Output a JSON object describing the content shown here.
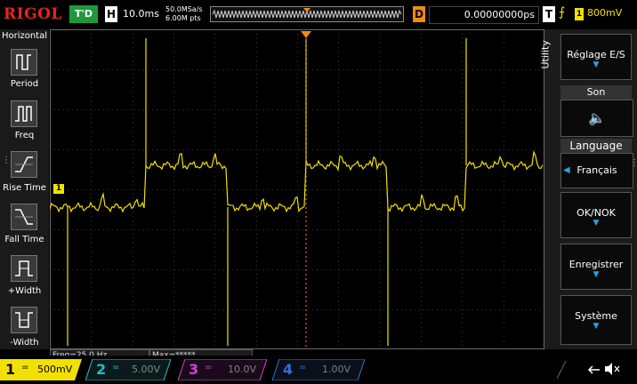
{
  "brand": {
    "logo": "RIGOL"
  },
  "top": {
    "status": "T'D",
    "horizontal_key": "H",
    "timebase": "10.0ms",
    "sample_rate": "50.0MSa/s",
    "memory_depth": "6.00M pts",
    "delay_key": "D",
    "delay_value": "0.00000000ps",
    "trigger_key": "T",
    "trigger_edge": "rising-edge-icon",
    "trigger_channel": "1",
    "trigger_level": "800mV"
  },
  "left_menu": {
    "title": "Horizontal",
    "items": [
      {
        "label": "Period",
        "icon": "period-icon"
      },
      {
        "label": "Freq",
        "icon": "freq-icon"
      },
      {
        "label": "Rise Time",
        "icon": "rise-time-icon"
      },
      {
        "label": "Fall Time",
        "icon": "fall-time-icon"
      },
      {
        "label": "+Width",
        "icon": "pos-width-icon"
      },
      {
        "label": "-Width",
        "icon": "neg-width-icon"
      }
    ]
  },
  "right_menu": {
    "title": "Utility",
    "items": [
      {
        "label": "Réglage E/S"
      },
      {
        "header": "Son",
        "label": "🔈"
      },
      {
        "header": "Language",
        "label": "Français"
      },
      {
        "label": "OK/NOK"
      },
      {
        "label": "Enregistrer"
      },
      {
        "label": "Système"
      }
    ]
  },
  "measurements": {
    "freq": "Freq=25.0 Hz",
    "max": "Max=*****"
  },
  "channels": [
    {
      "num": "1",
      "scale": "500mV",
      "color": "#f2e100"
    },
    {
      "num": "2",
      "scale": "5.00V",
      "color": "#19c3c8"
    },
    {
      "num": "3",
      "scale": "10.0V",
      "color": "#d63fd6"
    },
    {
      "num": "4",
      "scale": "1.00V",
      "color": "#2f6fe0"
    }
  ],
  "marker_ch1": "1",
  "trigger_marker": "T",
  "colors": {
    "trace": "#f2e100",
    "accent": "#2d9ce6",
    "trigger": "#f08a18"
  }
}
